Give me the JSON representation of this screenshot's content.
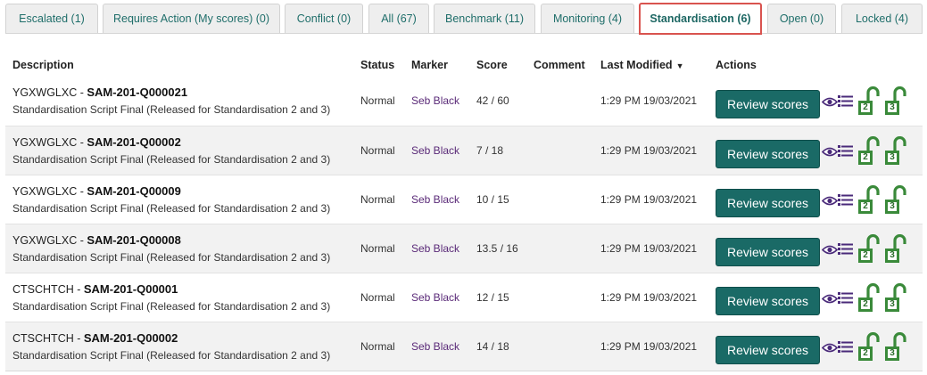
{
  "tabs": [
    {
      "label": "Escalated (1)",
      "active": false
    },
    {
      "label": "Requires Action (My scores) (0)",
      "active": false
    },
    {
      "label": "Conflict (0)",
      "active": false
    },
    {
      "label": "All (67)",
      "active": false
    },
    {
      "label": "Benchmark (11)",
      "active": false
    },
    {
      "label": "Monitoring (4)",
      "active": false
    },
    {
      "label": "Standardisation (6)",
      "active": true
    },
    {
      "label": "Open (0)",
      "active": false
    },
    {
      "label": "Locked (4)",
      "active": false
    }
  ],
  "columns": {
    "description": "Description",
    "status": "Status",
    "marker": "Marker",
    "score": "Score",
    "comment": "Comment",
    "last_modified": "Last Modified",
    "sort_indicator": "▼",
    "actions": "Actions"
  },
  "rows": [
    {
      "prefix": "YGXWGLXC - ",
      "code": "SAM-201-Q000021",
      "subtitle": "Standardisation Script Final (Released for Standardisation 2 and 3)",
      "status": "Normal",
      "marker": "Seb Black",
      "score": "42 / 60",
      "comment": "",
      "modified": "1:29 PM 19/03/2021",
      "action": "Review scores",
      "lock_labels": [
        "2",
        "3"
      ]
    },
    {
      "prefix": "YGXWGLXC - ",
      "code": "SAM-201-Q00002",
      "subtitle": "Standardisation Script Final (Released for Standardisation 2 and 3)",
      "status": "Normal",
      "marker": "Seb Black",
      "score": "7 / 18",
      "comment": "",
      "modified": "1:29 PM 19/03/2021",
      "action": "Review scores",
      "lock_labels": [
        "2",
        "3"
      ]
    },
    {
      "prefix": "YGXWGLXC - ",
      "code": "SAM-201-Q00009",
      "subtitle": "Standardisation Script Final (Released for Standardisation 2 and 3)",
      "status": "Normal",
      "marker": "Seb Black",
      "score": "10 / 15",
      "comment": "",
      "modified": "1:29 PM 19/03/2021",
      "action": "Review scores",
      "lock_labels": [
        "2",
        "3"
      ]
    },
    {
      "prefix": "YGXWGLXC - ",
      "code": "SAM-201-Q00008",
      "subtitle": "Standardisation Script Final (Released for Standardisation 2 and 3)",
      "status": "Normal",
      "marker": "Seb Black",
      "score": "13.5 / 16",
      "comment": "",
      "modified": "1:29 PM 19/03/2021",
      "action": "Review scores",
      "lock_labels": [
        "2",
        "3"
      ]
    },
    {
      "prefix": "CTSCHTCH - ",
      "code": "SAM-201-Q00001",
      "subtitle": "Standardisation Script Final (Released for Standardisation 2 and 3)",
      "status": "Normal",
      "marker": "Seb Black",
      "score": "12 / 15",
      "comment": "",
      "modified": "1:29 PM 19/03/2021",
      "action": "Review scores",
      "lock_labels": [
        "2",
        "3"
      ]
    },
    {
      "prefix": "CTSCHTCH - ",
      "code": "SAM-201-Q00002",
      "subtitle": "Standardisation Script Final (Released for Standardisation 2 and 3)",
      "status": "Normal",
      "marker": "Seb Black",
      "score": "14 / 18",
      "comment": "",
      "modified": "1:29 PM 19/03/2021",
      "action": "Review scores",
      "lock_labels": [
        "2",
        "3"
      ]
    }
  ],
  "colors": {
    "accent": "#1a6a66",
    "tab_text": "#1f6e6a",
    "active_tab_border": "#d9534f",
    "marker_link": "#5a2a78",
    "lock_green": "#3a8a3a",
    "icon_purple": "#4a2a7a"
  },
  "icons": {
    "eye": "eye-icon",
    "list": "list-icon",
    "lock": "unlocked-padlock-icon"
  }
}
